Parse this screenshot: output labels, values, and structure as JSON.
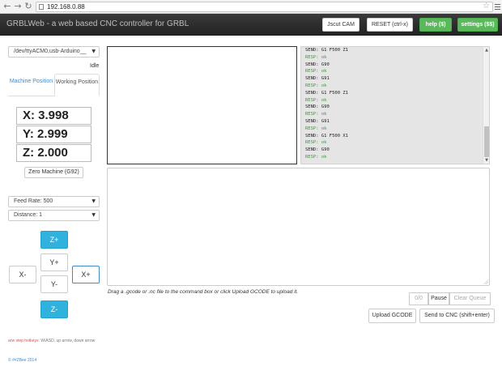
{
  "browser": {
    "url": "192.168.0.88"
  },
  "navbar": {
    "brand": "GRBLWeb - a web based CNC controller for GRBL",
    "jscut_label": "Jscut CAM",
    "reset_label": "RESET (ctrl-x)",
    "help_label": "help ($)",
    "settings_label": "settings ($$)"
  },
  "machine": {
    "port": "/dev/ttyACM0,usb-Arduino__",
    "status": "Idle",
    "tabs": [
      "Machine Position",
      "Working Position"
    ],
    "active_tab": "Working Position",
    "x": "X: 3.998",
    "y": "Y: 2.999",
    "z": "Z: 2.000",
    "zero_label": "Zero Machine (G92)",
    "feed_rate": "Feed Rate: 500",
    "distance": "Distance: 1"
  },
  "jog": {
    "z_plus": "Z+",
    "y_plus": "Y+",
    "x_minus": "X-",
    "x_plus": "X+",
    "y_minus": "Y-",
    "z_minus": "Z-"
  },
  "hotkeys": {
    "label": "arw step hotkeys:",
    "text": "W/ASD, up arrow, down arrow"
  },
  "copyright": "© ##ZBee 2014",
  "console": [
    {
      "type": "send",
      "text": "SEND: G1 F500 Z1"
    },
    {
      "type": "resp",
      "text": "RESP: ok"
    },
    {
      "type": "send",
      "text": "SEND: G90"
    },
    {
      "type": "resp",
      "text": "RESP: ok"
    },
    {
      "type": "send",
      "text": "SEND: G91"
    },
    {
      "type": "resp",
      "text": "RESP: ok"
    },
    {
      "type": "send",
      "text": "SEND: G1 F500 Z1"
    },
    {
      "type": "resp",
      "text": "RESP: ok"
    },
    {
      "type": "send",
      "text": "SEND: G90"
    },
    {
      "type": "resp",
      "text": "RESP: ok"
    },
    {
      "type": "send",
      "text": "SEND: G91"
    },
    {
      "type": "resp",
      "text": "RESP: ok"
    },
    {
      "type": "send",
      "text": "SEND: G1 F500 X1"
    },
    {
      "type": "resp",
      "text": "RESP: ok"
    },
    {
      "type": "send",
      "text": "SEND: G90"
    },
    {
      "type": "resp",
      "text": "RESP: ok"
    }
  ],
  "gcode": {
    "hint": "Drag a .gcode or .nc file to the command box or click Upload GCODE to upload it.",
    "queue_count": "0/0",
    "pause_label": "Pause",
    "clear_label": "Clear Queue",
    "upload_label": "Upload GCODE",
    "send_label": "Send to CNC (shift+enter)"
  },
  "colors": {
    "navbar": "#222222",
    "green": "#5cb85c",
    "jog_blue": "#2fb2dd",
    "resp_green": "#3a9a3a"
  }
}
